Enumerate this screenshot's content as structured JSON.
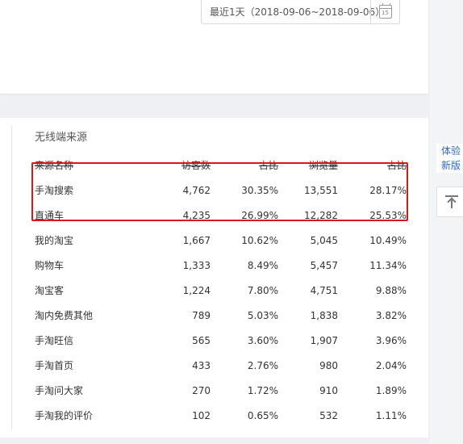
{
  "date_range": {
    "label": "最近1天（2018-09-06~2018-09-06）",
    "calendar_day": "15"
  },
  "section": {
    "title": "无线端来源"
  },
  "table": {
    "headers": [
      "来源名称",
      "访客数",
      "占比",
      "浏览量",
      "占比"
    ],
    "rows": [
      [
        "手淘搜索",
        "4,762",
        "30.35%",
        "13,551",
        "28.17%"
      ],
      [
        "直通车",
        "4,235",
        "26.99%",
        "12,282",
        "25.53%"
      ],
      [
        "我的淘宝",
        "1,667",
        "10.62%",
        "5,045",
        "10.49%"
      ],
      [
        "购物车",
        "1,333",
        "8.49%",
        "5,457",
        "11.34%"
      ],
      [
        "淘宝客",
        "1,224",
        "7.80%",
        "4,751",
        "9.88%"
      ],
      [
        "淘内免费其他",
        "789",
        "5.03%",
        "1,838",
        "3.82%"
      ],
      [
        "手淘旺信",
        "565",
        "3.60%",
        "1,907",
        "3.96%"
      ],
      [
        "手淘首页",
        "433",
        "2.76%",
        "980",
        "2.04%"
      ],
      [
        "手淘问大家",
        "270",
        "1.72%",
        "910",
        "1.89%"
      ],
      [
        "手淘我的评价",
        "102",
        "0.65%",
        "532",
        "1.11%"
      ]
    ]
  },
  "side": {
    "experience_line1": "体验",
    "experience_line2": "新版"
  },
  "colors": {
    "highlight": "#d9171a",
    "link": "#2f6cb5"
  }
}
